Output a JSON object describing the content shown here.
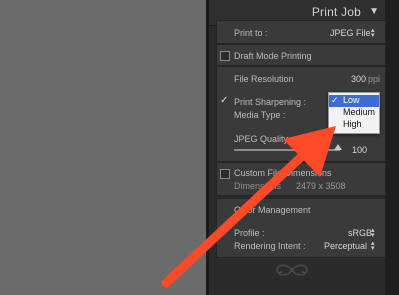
{
  "panel": {
    "title": "Print Job",
    "print_to_label": "Print to :",
    "print_to_value": "JPEG File",
    "draft_mode_label": "Draft Mode Printing",
    "file_resolution_label": "File Resolution",
    "file_resolution_value": "300",
    "file_resolution_unit": "ppi",
    "print_sharpening_label": "Print Sharpening :",
    "media_type_label": "Media Type :",
    "jpeg_quality_label": "JPEG Quality",
    "jpeg_quality_value": "100",
    "custom_dimensions_label": "Custom File Dimensions",
    "dimensions_label": "Dimensions",
    "dimensions_value": "2479 x 3508",
    "color_management_label": "Color Management",
    "profile_label": "Profile :",
    "profile_value": "sRGB",
    "rendering_intent_label": "Rendering Intent :",
    "rendering_intent_value": "Perceptual"
  },
  "dropdown": {
    "options": [
      "Low",
      "Medium",
      "High"
    ],
    "selected": "Low",
    "check": "✓"
  },
  "colors": {
    "panel_bg": "#2b2b2b",
    "section_bg": "#3a3a3a",
    "arrow": "#f04a2b",
    "selection": "#3b6ed0"
  }
}
